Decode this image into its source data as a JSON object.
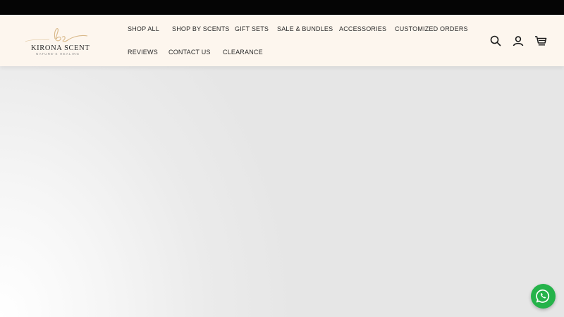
{
  "brand": {
    "name": "KIRONA SCENT",
    "tagline": "NATURE'S HEALING",
    "accent_color": "#d9b98a"
  },
  "nav": {
    "row1": [
      "SHOP ALL",
      "SHOP BY SCENTS",
      "GIFT SETS",
      "SALE & BUNDLES",
      "ACCESSORIES",
      "CUSTOMIZED ORDERS"
    ],
    "row2": [
      "REVIEWS",
      "CONTACT US",
      "CLEARANCE"
    ]
  },
  "header_icons": [
    "search-icon",
    "account-icon",
    "cart-icon"
  ],
  "floating": {
    "icon": "whatsapp-icon",
    "color": "#25b34a"
  }
}
